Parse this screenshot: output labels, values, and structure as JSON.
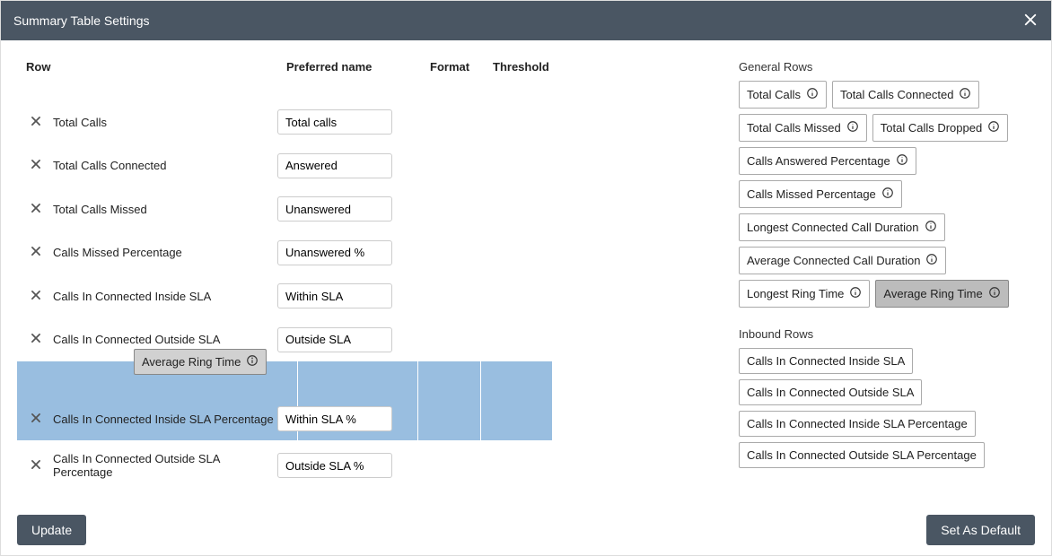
{
  "header": {
    "title": "Summary Table Settings"
  },
  "columns": {
    "row": "Row",
    "preferred": "Preferred name",
    "format": "Format",
    "threshold": "Threshold"
  },
  "rows": [
    {
      "label": "Total Calls",
      "value": "Total calls"
    },
    {
      "label": "Total Calls Connected",
      "value": "Answered"
    },
    {
      "label": "Total Calls Missed",
      "value": "Unanswered"
    },
    {
      "label": "Calls Missed Percentage",
      "value": "Unanswered %"
    },
    {
      "label": "Calls In Connected Inside SLA",
      "value": "Within SLA"
    },
    {
      "label": "Calls In Connected Outside SLA",
      "value": "Outside SLA"
    },
    {
      "label": "Calls In Connected Inside SLA Percentage",
      "value": "Within SLA %"
    },
    {
      "label": "Calls In Connected Outside SLA Percentage",
      "value": "Outside SLA %"
    }
  ],
  "dragging": {
    "label": "Average Ring Time"
  },
  "right": {
    "general_title": "General Rows",
    "general": [
      {
        "label": "Total Calls",
        "info": true
      },
      {
        "label": "Total Calls Connected",
        "info": true
      },
      {
        "label": "Total Calls Missed",
        "info": true
      },
      {
        "label": "Total Calls Dropped",
        "info": true
      },
      {
        "label": "Calls Answered Percentage",
        "info": true
      },
      {
        "label": "Calls Missed Percentage",
        "info": true
      },
      {
        "label": "Longest Connected Call Duration",
        "info": true
      },
      {
        "label": "Average Connected Call Duration",
        "info": true
      },
      {
        "label": "Longest Ring Time",
        "info": true
      },
      {
        "label": "Average Ring Time",
        "info": true,
        "selected": true
      }
    ],
    "inbound_title": "Inbound Rows",
    "inbound": [
      {
        "label": "Calls In Connected Inside SLA"
      },
      {
        "label": "Calls In Connected Outside SLA"
      },
      {
        "label": "Calls In Connected Inside SLA Percentage"
      },
      {
        "label": "Calls In Connected Outside SLA Percentage"
      }
    ]
  },
  "buttons": {
    "update": "Update",
    "set_default": "Set As Default"
  }
}
